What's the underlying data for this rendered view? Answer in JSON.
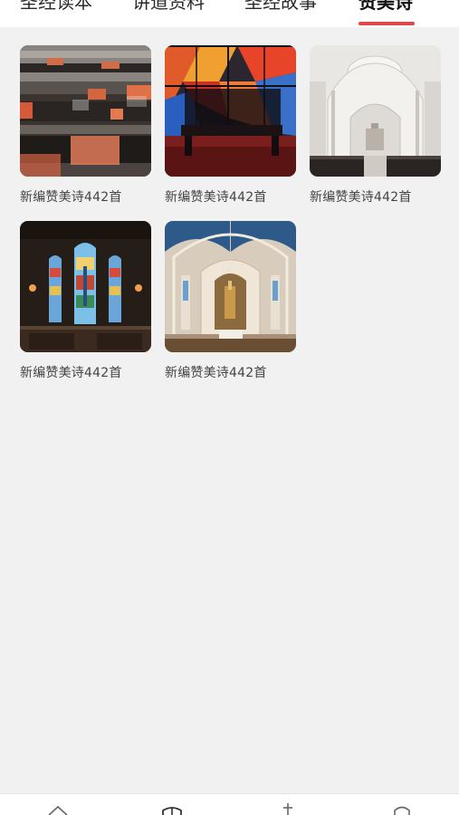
{
  "tabs": [
    {
      "label": "圣经读本"
    },
    {
      "label": "讲道资料"
    },
    {
      "label": "圣经故事"
    },
    {
      "label": "赞美诗",
      "active": true
    }
  ],
  "accent_color": "#e04848",
  "items": [
    {
      "title": "新编赞美诗442首",
      "image": "church-pews"
    },
    {
      "title": "新编赞美诗442首",
      "image": "stained-glass-bench"
    },
    {
      "title": "新编赞美诗442首",
      "image": "white-cathedral-interior"
    },
    {
      "title": "新编赞美诗442首",
      "image": "stained-glass-windows"
    },
    {
      "title": "新编赞美诗442首",
      "image": "gothic-altar"
    }
  ],
  "bottom_nav": [
    {
      "icon": "home-icon"
    },
    {
      "icon": "book-icon"
    },
    {
      "icon": "cross-icon"
    },
    {
      "icon": "profile-icon"
    }
  ]
}
